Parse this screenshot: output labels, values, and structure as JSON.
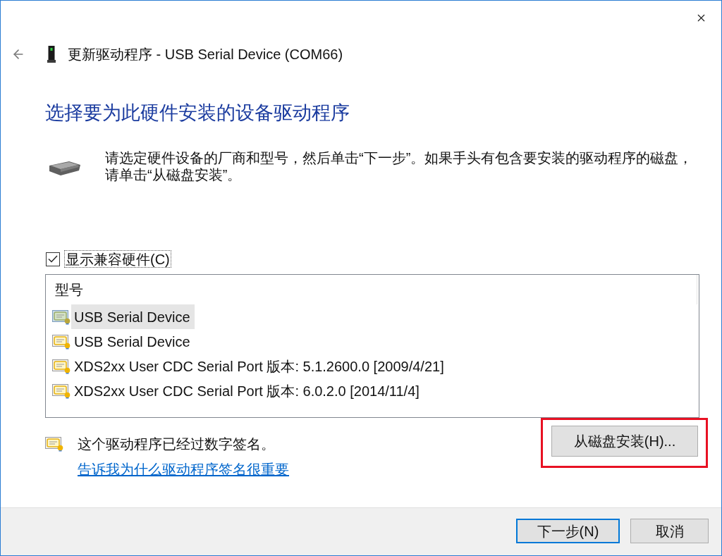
{
  "window": {
    "title": "更新驱动程序 - USB Serial Device (COM66)"
  },
  "heading": "选择要为此硬件安装的设备驱动程序",
  "instructions": "请选定硬件设备的厂商和型号，然后单击“下一步”。如果手头有包含要安装的驱动程序的磁盘，请单击“从磁盘安装”。",
  "show_compatible": {
    "label": "显示兼容硬件(C)",
    "checked": true,
    "focused": true
  },
  "model_list": {
    "header": "型号",
    "items": [
      {
        "label": "USB Serial Device",
        "selected": true
      },
      {
        "label": "USB Serial Device",
        "selected": false
      },
      {
        "label": "XDS2xx User CDC Serial Port 版本: 5.1.2600.0 [2009/4/21]",
        "selected": false
      },
      {
        "label": "XDS2xx User CDC Serial Port 版本: 6.0.2.0 [2014/11/4]",
        "selected": false
      }
    ]
  },
  "signature": {
    "status": "这个驱动程序已经过数字签名。",
    "link": "告诉我为什么驱动程序签名很重要"
  },
  "have_disk_button": {
    "label": "从磁盘安装(H)...",
    "highlighted": true
  },
  "buttons": [
    {
      "label": "下一步(N)",
      "default": true
    },
    {
      "label": "取消",
      "default": false
    }
  ]
}
